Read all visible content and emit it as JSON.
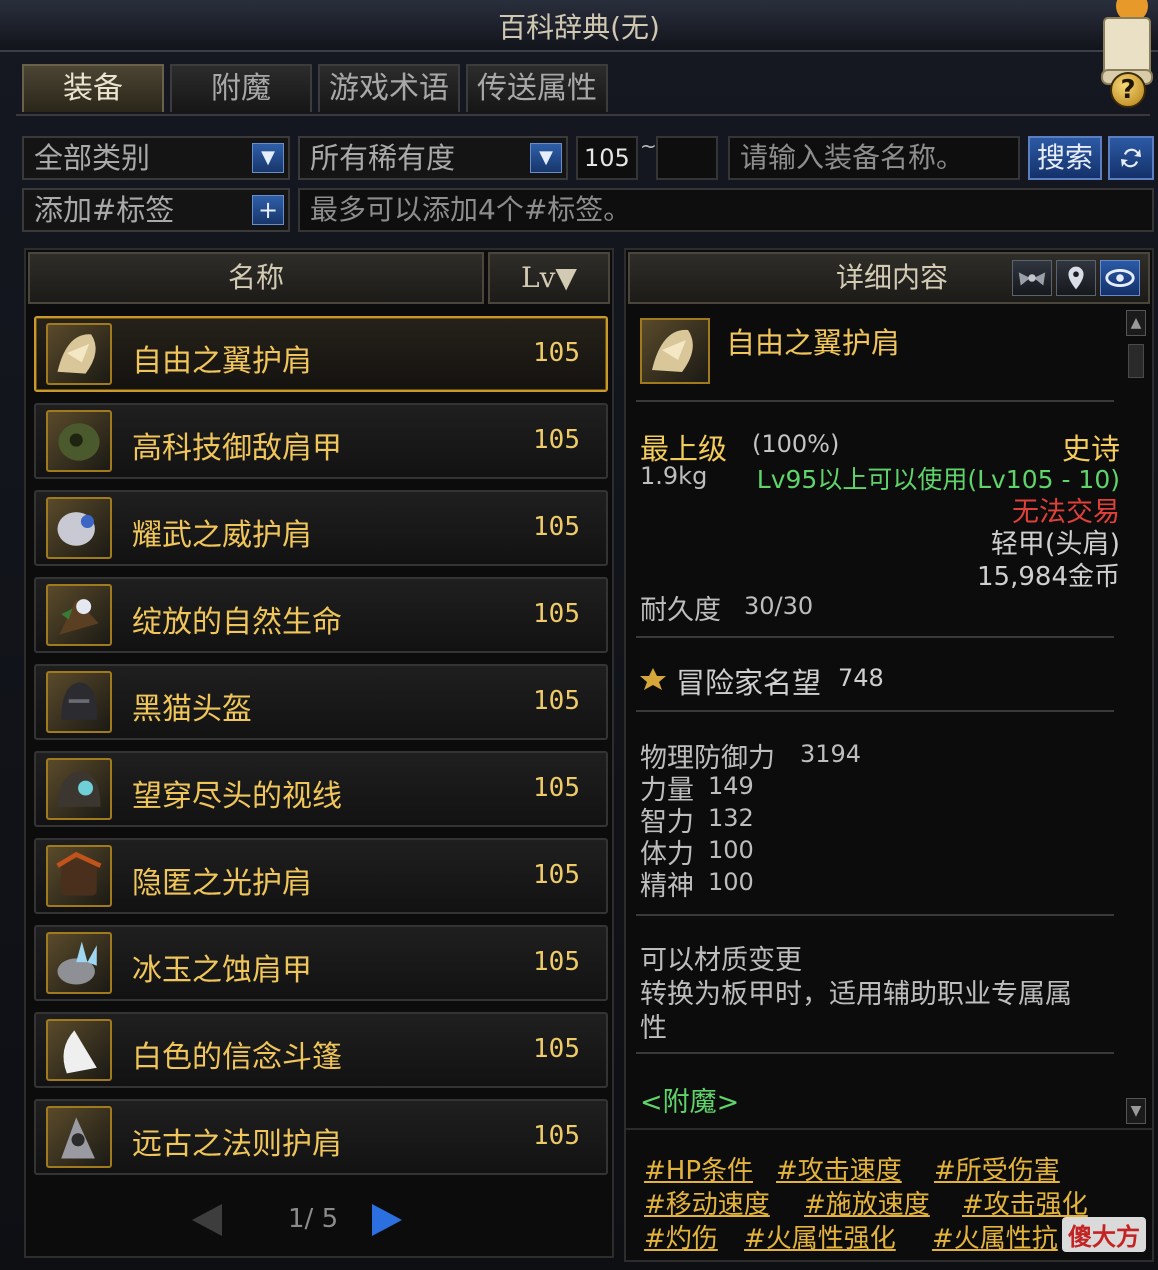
{
  "window": {
    "title": "百科辞典(无)",
    "help_symbol": "?"
  },
  "tabs": [
    {
      "label": "装备",
      "active": true
    },
    {
      "label": "附魔",
      "active": false
    },
    {
      "label": "游戏术语",
      "active": false
    },
    {
      "label": "传送属性",
      "active": false
    }
  ],
  "filters": {
    "category": "全部类别",
    "rarity": "所有稀有度",
    "level_min": "105",
    "level_tilde": "~",
    "level_max": "",
    "name_placeholder": "请输入装备名称。",
    "search_label": "搜索",
    "refresh_icon": "refresh-icon",
    "tag_add_placeholder": "添加#标签",
    "tag_add_symbol": "+",
    "tag_hint": "最多可以添加4个#标签。"
  },
  "list": {
    "header_name": "名称",
    "header_lv": "Lv▼",
    "items": [
      {
        "name": "自由之翼护肩",
        "lv": "105",
        "selected": true
      },
      {
        "name": "高科技御敌肩甲",
        "lv": "105"
      },
      {
        "name": "耀武之威护肩",
        "lv": "105"
      },
      {
        "name": "绽放的自然生命",
        "lv": "105"
      },
      {
        "name": "黑猫头盔",
        "lv": "105"
      },
      {
        "name": "望穿尽头的视线",
        "lv": "105"
      },
      {
        "name": "隐匿之光护肩",
        "lv": "105"
      },
      {
        "name": "冰玉之蚀肩甲",
        "lv": "105"
      },
      {
        "name": "白色的信念斗篷",
        "lv": "105"
      },
      {
        "name": "远古之法则护肩",
        "lv": "105"
      }
    ],
    "pagination": "1/ 5"
  },
  "detail": {
    "header": "详细内容",
    "item_name": "自由之翼护肩",
    "grade": "最上级",
    "grade_pct": "(100%)",
    "rarity": "史诗",
    "weight": "1.9kg",
    "level_req": "Lv95以上可以使用(Lv105 - 10)",
    "trade": "无法交易",
    "slot": "轻甲(头肩)",
    "price": "15,984金币",
    "durability_label": "耐久度",
    "durability": "30/30",
    "fame_label": "冒险家名望",
    "fame": "748",
    "stats": [
      {
        "label": "物理防御力",
        "value": "3194"
      },
      {
        "label": "力量",
        "value": "149"
      },
      {
        "label": "智力",
        "value": "132"
      },
      {
        "label": "体力",
        "value": "100"
      },
      {
        "label": "精神",
        "value": "100"
      }
    ],
    "note_line1": "可以材质变更",
    "note_line2": "转换为板甲时，适用辅助职业专属属",
    "note_line3": "性",
    "enchant": "<附魔>",
    "tags": [
      "#HP条件",
      "#攻击速度",
      "#所受伤害",
      "#移动速度",
      "#施放速度",
      "#攻击强化",
      "#灼伤",
      "#火属性强化",
      "#火属性抗"
    ]
  },
  "watermark": "傻大方",
  "colors": {
    "gold_text": "#f0c55a",
    "green_text": "#5fd46a",
    "red_text": "#e0403a",
    "epic": "#f3cc5a",
    "tag_text": "#e3b33c"
  }
}
